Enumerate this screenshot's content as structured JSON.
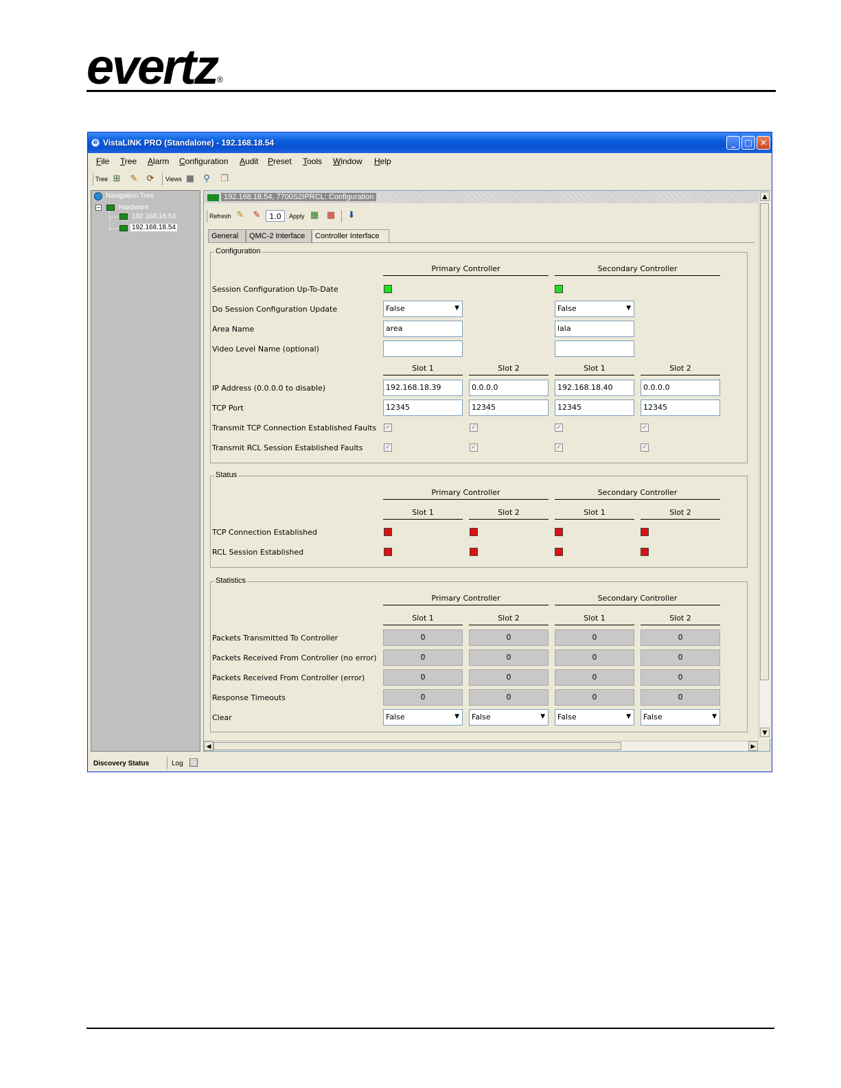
{
  "brand": {
    "logo_text": "evertz",
    "registered_mark": "®"
  },
  "window": {
    "title": "VistaLINK PRO (Standalone) - 192.168.18.54",
    "controls": {
      "minimize": "_",
      "maximize": "□",
      "close": "✕"
    }
  },
  "menu": [
    "File",
    "Tree",
    "Alarm",
    "Configuration",
    "Audit",
    "Preset",
    "Tools",
    "Window",
    "Help"
  ],
  "toolbar": {
    "tree_label": "Tree",
    "views_label": "Views"
  },
  "nav": {
    "root": "Navigation Tree",
    "hardware": "Hardware",
    "items": [
      "192.168.18.53",
      "192.168.18.54"
    ],
    "selected": "192.168.18.54"
  },
  "panel": {
    "header": "192.168.18.54, 7700S2IPRCL: Configuration",
    "refresh_label": "Refresh",
    "zoom_value": "1.0",
    "apply_label": "Apply",
    "tabs": [
      "General",
      "QMC-2 Interface",
      "Controller Interface"
    ],
    "active_tab": "Controller Interface"
  },
  "config": {
    "title": "Configuration",
    "primary": "Primary Controller",
    "secondary": "Secondary Controller",
    "slot1": "Slot 1",
    "slot2": "Slot 2",
    "labels": {
      "session": "Session Configuration Up-To-Date",
      "do_update": "Do Session Configuration Update",
      "area": "Area Name",
      "video": "Video Level Name (optional)",
      "ip": "IP Address (0.0.0.0 to disable)",
      "tcp": "TCP Port",
      "tcp_faults": "Transmit TCP Connection Established Faults",
      "rcl_faults": "Transmit RCL Session Established Faults"
    },
    "do_update": {
      "primary": "False",
      "secondary": "False"
    },
    "area": {
      "primary": "area",
      "secondary": "lala"
    },
    "video": {
      "primary": "",
      "secondary": ""
    },
    "ip": [
      "192.168.18.39",
      "0.0.0.0",
      "192.168.18.40",
      "0.0.0.0"
    ],
    "tcp": [
      "12345",
      "12345",
      "12345",
      "12345"
    ],
    "check_mark": "✓"
  },
  "status": {
    "title": "Status",
    "primary": "Primary Controller",
    "secondary": "Secondary Controller",
    "slot1": "Slot 1",
    "slot2": "Slot 2",
    "labels": {
      "tcp": "TCP Connection Established",
      "rcl": "RCL Session Established"
    }
  },
  "stats": {
    "title": "Statistics",
    "primary": "Primary Controller",
    "secondary": "Secondary Controller",
    "slot1": "Slot 1",
    "slot2": "Slot 2",
    "labels": {
      "tx": "Packets Transmitted To Controller",
      "rx_ok": "Packets Received From Controller (no error)",
      "rx_err": "Packets Received From Controller (error)",
      "timeouts": "Response Timeouts",
      "clear": "Clear"
    },
    "tx": [
      "0",
      "0",
      "0",
      "0"
    ],
    "rx_ok": [
      "0",
      "0",
      "0",
      "0"
    ],
    "rx_err": [
      "0",
      "0",
      "0",
      "0"
    ],
    "timeouts": [
      "0",
      "0",
      "0",
      "0"
    ],
    "clear": [
      "False",
      "False",
      "False",
      "False"
    ]
  },
  "statusbar": {
    "discovery": "Discovery Status",
    "log": "Log"
  },
  "colors": {
    "title_bar": "#0a5fe0",
    "led_green": "#22dd22",
    "led_red": "#dd1111",
    "nav_bg": "#c0c0c0",
    "window_bg": "#ece9d8"
  }
}
